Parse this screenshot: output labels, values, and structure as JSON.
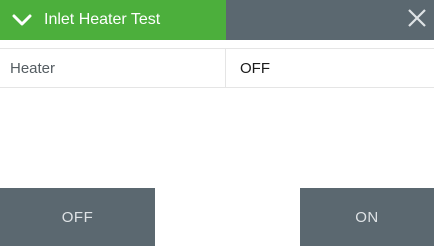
{
  "dialog": {
    "title": "Inlet Heater Test",
    "header_color": "#4caf3c",
    "header_dark_color": "#5b6870",
    "collapse_icon": "chevron-down-icon",
    "close_icon": "close-icon"
  },
  "status_row": {
    "label": "Heater",
    "value": "OFF"
  },
  "buttons": {
    "off_label": "OFF",
    "on_label": "ON"
  }
}
